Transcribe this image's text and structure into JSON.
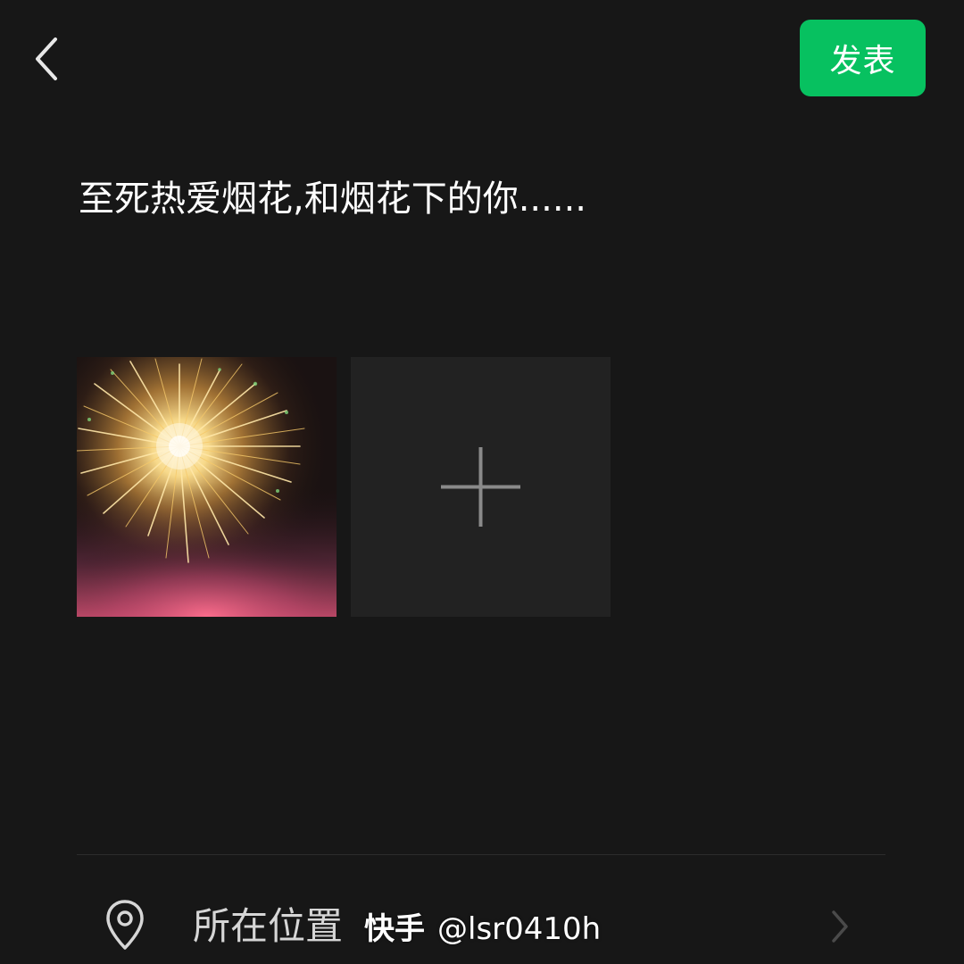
{
  "header": {
    "back_icon": "chevron-left-icon",
    "publish_label": "发表",
    "publish_color": "#07c160"
  },
  "post": {
    "text": "至死热爱烟花,和烟花下的你......"
  },
  "photos": {
    "items": [
      {
        "type": "image",
        "subject": "fireworks"
      }
    ],
    "add_icon": "plus-icon"
  },
  "location": {
    "icon": "map-pin-icon",
    "label": "所在位置",
    "chevron_icon": "chevron-right-icon"
  },
  "watermark": {
    "brand": "快手",
    "handle": "@lsr0410h"
  },
  "colors": {
    "background": "#171717",
    "accent": "#07c160"
  }
}
